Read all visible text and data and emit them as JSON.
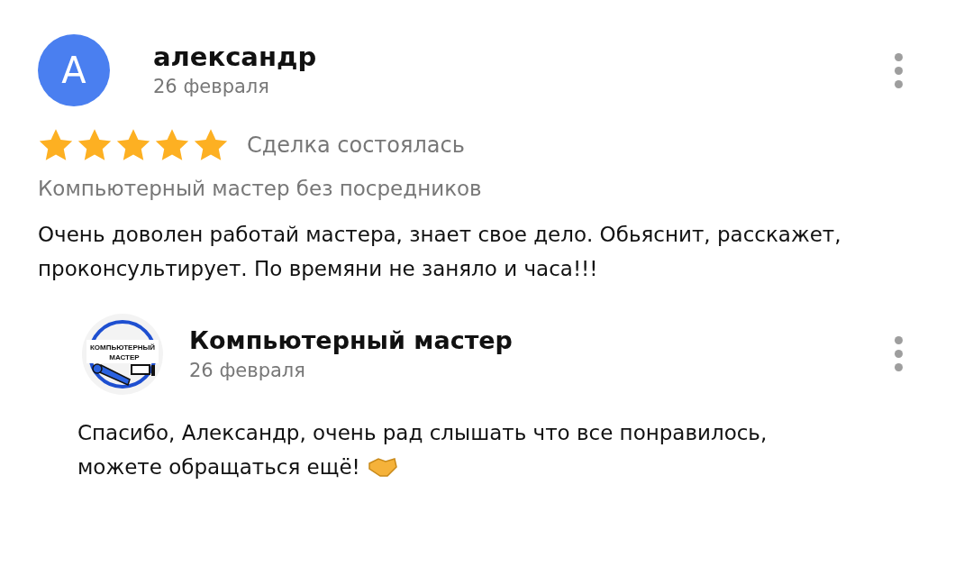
{
  "review": {
    "avatar_letter": "А",
    "author": "александр",
    "date": "26 февраля",
    "stars": 5,
    "deal_status": "Сделка состоялась",
    "service": "Компьютерный мастер без посредников",
    "text": "Очень доволен работай мастера, знает свое дело. Обьяснит, расскажет, проконсультирует. По времяни не заняло и часа!!!"
  },
  "reply": {
    "logo_lines": [
      "КОМПЬЮТЕРНЫЙ",
      "МАСТЕР"
    ],
    "author": "Компьютерный мастер",
    "date": "26 февраля",
    "text": "Спасибо, Александр, очень рад слышать что все понравилось, можете обращаться ещё!"
  }
}
